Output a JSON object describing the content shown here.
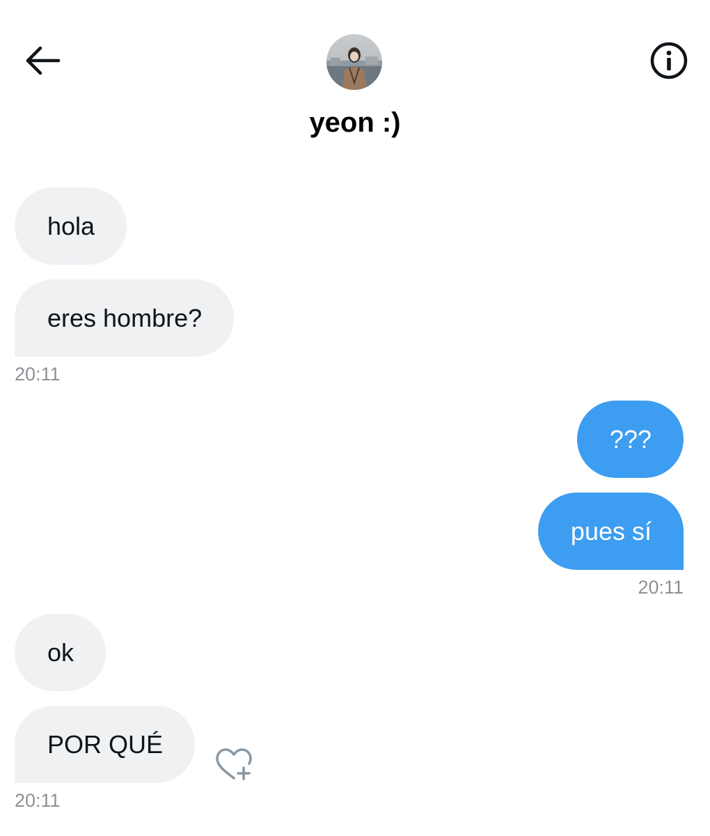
{
  "header": {
    "contact_name": "yeon :)",
    "back_icon": "arrow-left-icon",
    "info_icon": "info-icon"
  },
  "messages": [
    {
      "side": "received",
      "text": "hola"
    },
    {
      "side": "received",
      "text": "eres hombre?"
    },
    {
      "side": "received_time",
      "text": "20:11"
    },
    {
      "side": "sent",
      "text": "???"
    },
    {
      "side": "sent",
      "text": "pues sí"
    },
    {
      "side": "sent_time",
      "text": "20:11"
    },
    {
      "side": "received",
      "text": "ok"
    },
    {
      "side": "received",
      "text": "POR QUÉ"
    },
    {
      "side": "received_time",
      "text": "20:11"
    }
  ],
  "thread": {
    "m1": "hola",
    "m2": "eres hombre?",
    "t1": "20:11",
    "m3": "???",
    "m4": "pues sí",
    "t2": "20:11",
    "m5": "ok",
    "m6": "POR QUÉ",
    "t3": "20:11"
  },
  "reaction_icon": "heart-plus-icon",
  "colors": {
    "sent_bubble": "#3d9df0",
    "received_bubble": "#eff1f3",
    "timestamp": "#8b9196",
    "reaction_icon": "#8899a6"
  }
}
